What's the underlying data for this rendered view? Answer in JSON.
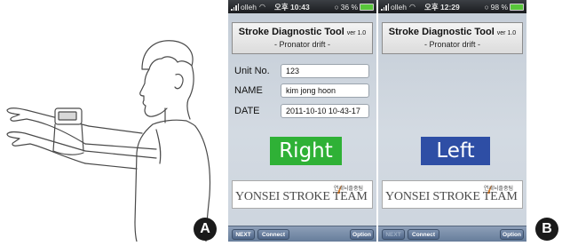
{
  "labels": {
    "panel_a": "A",
    "panel_b": "B"
  },
  "screens": [
    {
      "status": {
        "carrier": "olleh",
        "time": "오후 10:43",
        "battery": "36 %"
      },
      "title": "Stroke Diagnostic Tool",
      "version": "ver 1.0",
      "subtitle": "- Pronator drift -",
      "form": {
        "unit_label": "Unit No.",
        "unit_value": "123",
        "name_label": "NAME",
        "name_value": "kim jong hoon",
        "date_label": "DATE",
        "date_value": "2011-10-10 10-43-17"
      },
      "side_button": "Right",
      "logo": {
        "text": "YONSEI STROKE TEAM",
        "korean": "연세뇌졸중팀"
      },
      "toolbar": {
        "next": "NEXT",
        "connect": "Connect",
        "option": "Option"
      }
    },
    {
      "status": {
        "carrier": "olleh",
        "time": "오후 12:29",
        "battery": "98 %"
      },
      "title": "Stroke Diagnostic Tool",
      "version": "ver 1.0",
      "subtitle": "- Pronator drift -",
      "side_button": "Left",
      "logo": {
        "text": "YONSEI STROKE TEAM",
        "korean": "연세뇌졸중팀"
      },
      "toolbar": {
        "next": "NEXT",
        "connect": "Connect",
        "option": "Option"
      }
    }
  ],
  "colors": {
    "right_button": "#2fb136",
    "left_button": "#2e4ea5",
    "toolbar": "#6f84a2"
  }
}
